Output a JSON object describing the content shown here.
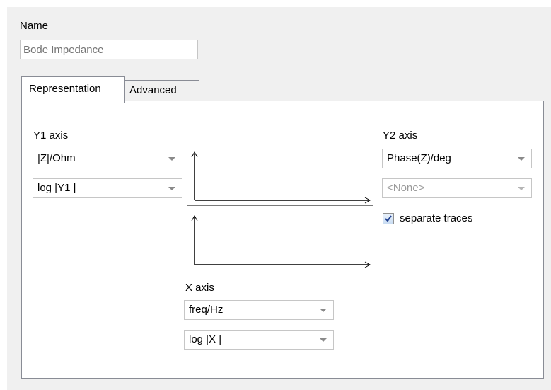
{
  "name": {
    "label": "Name",
    "placeholder": "Bode Impedance"
  },
  "tabs": [
    {
      "label": "Representation",
      "active": true
    },
    {
      "label": "Advanced",
      "active": false
    }
  ],
  "y1_axis": {
    "label": "Y1 axis",
    "quantity": "|Z|/Ohm",
    "scale": "log |Y1 |"
  },
  "y2_axis": {
    "label": "Y2 axis",
    "quantity": "Phase(Z)/deg",
    "secondary": "<None>",
    "secondary_disabled": true,
    "separate_traces_label": "separate traces",
    "separate_traces_checked": true
  },
  "x_axis": {
    "label": "X  axis",
    "quantity": "freq/Hz",
    "scale": "log |X |"
  },
  "colors": {
    "checkbox_check": "#1f3f8f",
    "tab_border": "#898c95",
    "disabled_text": "#9a9a9a"
  },
  "icons": [
    "chevron-down-icon",
    "checkmark-icon",
    "axes-preview-icon"
  ]
}
